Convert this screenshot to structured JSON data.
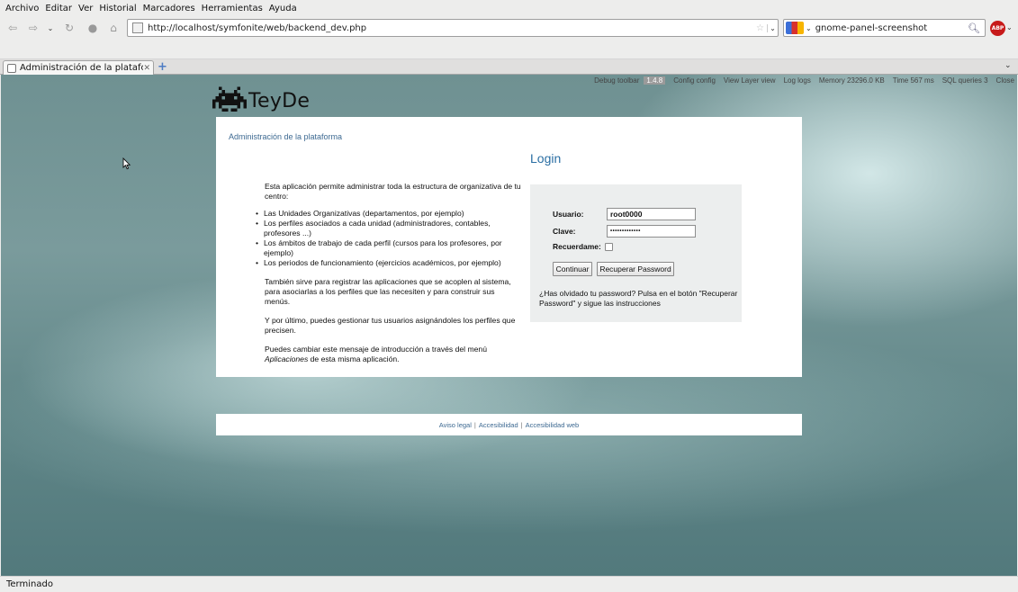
{
  "menubar": {
    "items": [
      "Archivo",
      "Editar",
      "Ver",
      "Historial",
      "Marcadores",
      "Herramientas",
      "Ayuda"
    ]
  },
  "navbar": {
    "url": "http://localhost/symfonite/web/backend_dev.php",
    "search_value": "gnome-panel-screenshot",
    "adblock_label": "ABP"
  },
  "tab": {
    "title": "Administración de la plataforma"
  },
  "debug_toolbar": {
    "label": "Debug toolbar",
    "version": "1.4.8",
    "config": "Config config",
    "view_layer": "View Layer view",
    "logs": "Log logs",
    "memory": "Memory 23296.0 KB",
    "time": "Time 567 ms",
    "sql": "SQL queries 3",
    "close": "Close"
  },
  "logo": {
    "text": "TeyDe"
  },
  "page": {
    "subtitle": "Administración de la plataforma",
    "title": "Login"
  },
  "intro": {
    "p1": "Esta aplicación permite administrar toda la estructura de organizativa de tu centro:",
    "items": [
      "Las Unidades Organizativas (departamentos, por ejemplo)",
      "Los perfiles asociados a cada unidad (administradores, contables, profesores ...)",
      "Los ámbitos de trabajo de cada perfil (cursos para los profesores, por ejemplo)",
      "Los periodos de funcionamiento (ejercicios académicos, por ejemplo)"
    ],
    "p2": "También sirve para registrar las aplicaciones que se acoplen al sistema, para asociarlas a los perfiles que las necesiten y para construir sus menús.",
    "p3": "Y por último, puedes gestionar tus usuarios asignándoles los perfiles que precisen.",
    "p4_prefix": "Puedes cambiar este mensaje de introducción a través del menú ",
    "p4_em": "Aplicaciones",
    "p4_suffix": " de esta misma aplicación."
  },
  "login": {
    "user_label": "Usuario:",
    "user_value": "root0000",
    "password_label": "Clave:",
    "password_value": "•••••••••••••",
    "remember_label": "Recuerdame:",
    "remember_checked": false,
    "continue_button": "Continuar",
    "recover_button": "Recuperar Password",
    "help_text": "¿Has olvidado tu password? Pulsa en el botón \"Recuperar Password\" y sigue las instrucciones"
  },
  "footer": {
    "links": [
      "Aviso legal",
      "Accesibilidad",
      "Accesibilidad web"
    ],
    "separator": "|"
  },
  "statusbar": {
    "text": "Terminado"
  },
  "colors": {
    "background_teal": "#5f8587",
    "link_blue": "#3e6a92",
    "title_blue": "#2a6ea3",
    "login_box": "#eceeee"
  }
}
